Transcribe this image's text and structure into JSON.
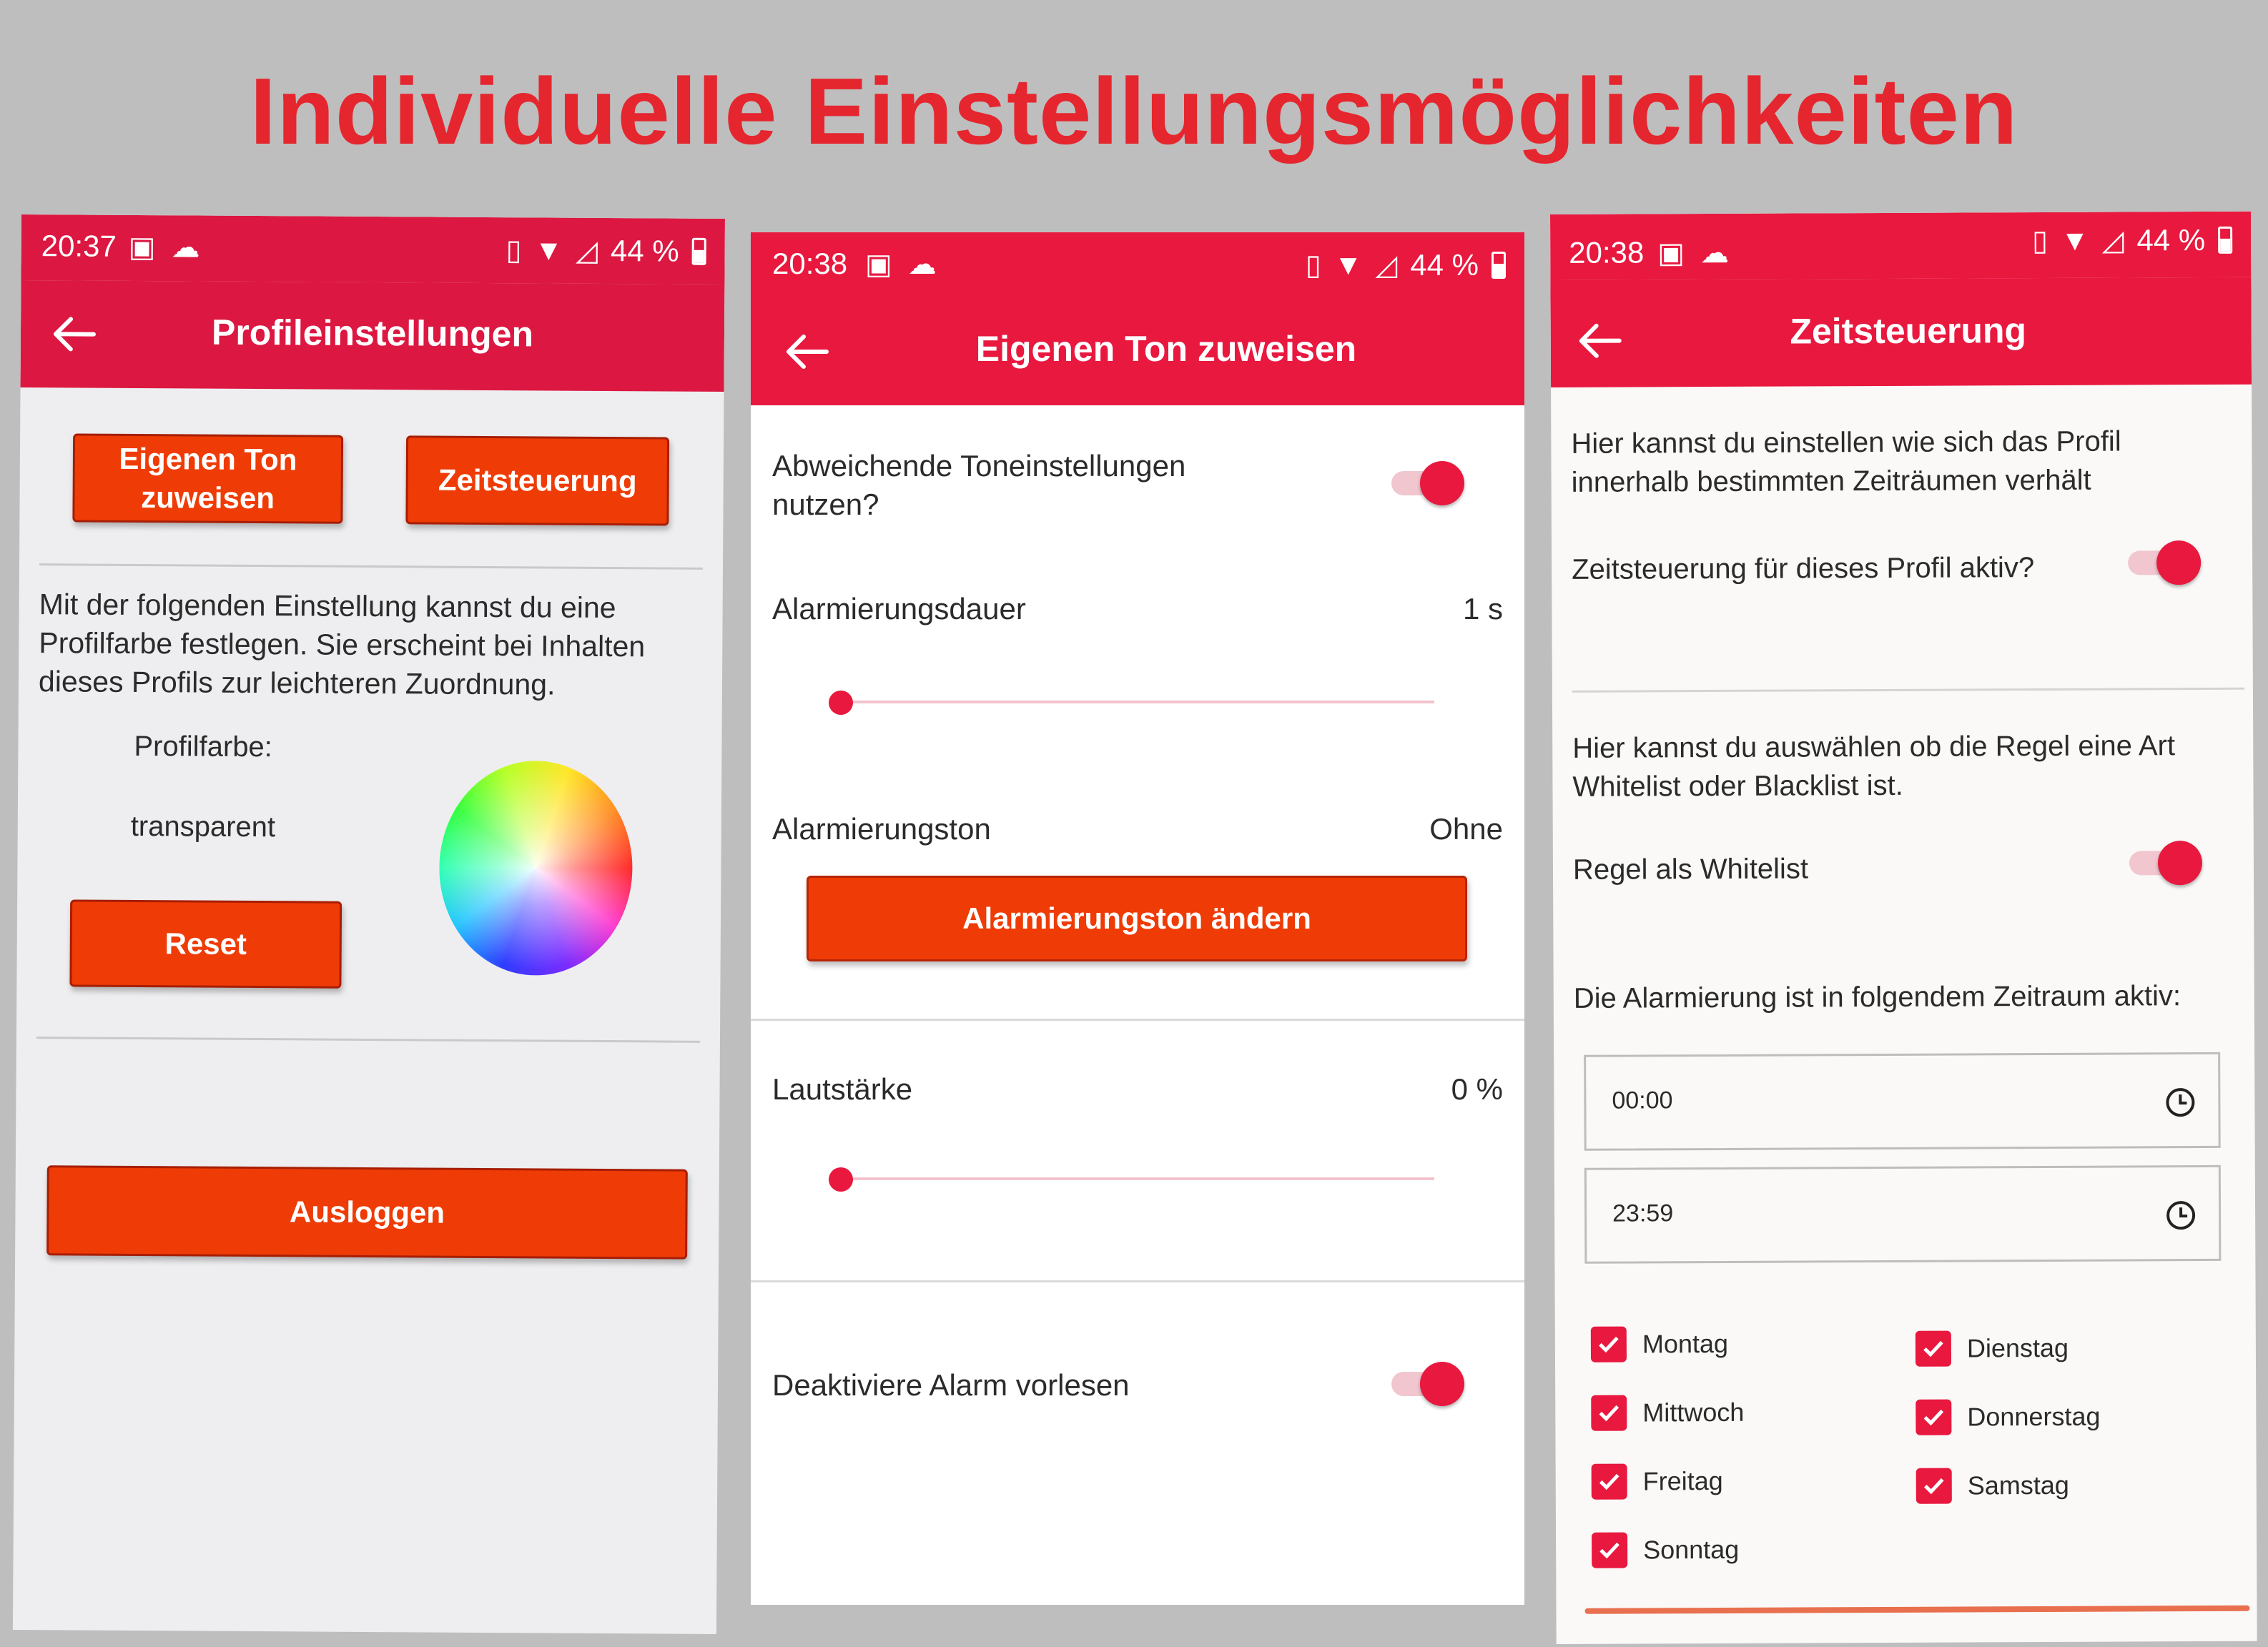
{
  "headline": "Individuelle Einstellungsmöglichkeiten",
  "colors": {
    "headline": "#e5262e",
    "appbar": "#e8183f",
    "button": "#ef3b05"
  },
  "screens": [
    {
      "status": {
        "time": "20:37",
        "battery": "44 %"
      },
      "title": "Profileinstellungen",
      "buttons": {
        "own_tone": "Eigenen Ton zuweisen",
        "time_control": "Zeitsteuerung",
        "reset": "Reset",
        "logout": "Ausloggen"
      },
      "description": "Mit der folgenden Einstellung kannst du eine Profilfarbe festlegen. Sie erscheint bei Inhalten dieses Profils zur leichteren Zuordnung.",
      "color_label": "Profilfarbe:",
      "color_value": "transparent"
    },
    {
      "status": {
        "time": "20:38",
        "battery": "44 %"
      },
      "title": "Eigenen Ton zuweisen",
      "deviating_label": "Abweichende Toneinstellungen nutzen?",
      "deviating_on": true,
      "duration_label": "Alarmierungsdauer",
      "duration_value": "1 s",
      "duration_fraction": 0,
      "tone_label": "Alarmierungston",
      "tone_value": "Ohne",
      "tone_button": "Alarmierungston ändern",
      "volume_label": "Lautstärke",
      "volume_value": "0 %",
      "volume_fraction": 0,
      "read_alarm_label": "Deaktiviere Alarm vorlesen",
      "read_alarm_on": true
    },
    {
      "status": {
        "time": "20:38",
        "battery": "44 %"
      },
      "title": "Zeitsteuerung",
      "intro": "Hier kannst du einstellen wie sich das Profil innerhalb bestimmten Zeiträumen verhält",
      "active_label": "Zeitsteuerung für dieses Profil aktiv?",
      "active_on": true,
      "rule_intro": "Hier kannst du auswählen ob die Regel eine Art Whitelist oder Blacklist ist.",
      "whitelist_label": "Regel als Whitelist",
      "whitelist_on": true,
      "period_label": "Die Alarmierung ist in folgendem Zeitraum aktiv:",
      "start_time": "00:00",
      "end_time": "23:59",
      "days": [
        {
          "label": "Montag",
          "checked": true
        },
        {
          "label": "Dienstag",
          "checked": true
        },
        {
          "label": "Mittwoch",
          "checked": true
        },
        {
          "label": "Donnerstag",
          "checked": true
        },
        {
          "label": "Freitag",
          "checked": true
        },
        {
          "label": "Samstag",
          "checked": true
        },
        {
          "label": "Sonntag",
          "checked": true
        }
      ]
    }
  ]
}
